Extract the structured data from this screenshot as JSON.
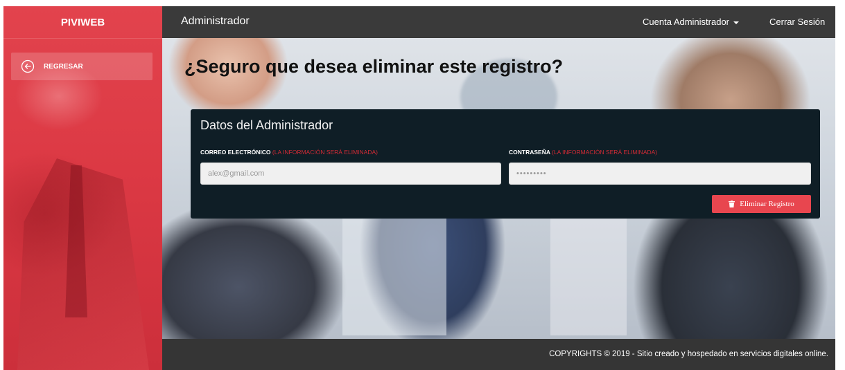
{
  "sidebar": {
    "brand": "PIVIWEB",
    "back_label": "REGRESAR",
    "back_icon": "arrow-left-circle-icon"
  },
  "topbar": {
    "title": "Administrador",
    "account_label": "Cuenta Administrador",
    "logout_label": "Cerrar Sesión"
  },
  "main": {
    "heading": "¿Seguro que desea eliminar este registro?",
    "card": {
      "title": "Datos del Administrador",
      "email_label": "CORREO ELECTRÓNICO",
      "email_note": "(LA INFORMACIÓN SERÁ ELIMINADA)",
      "email_value": "alex@gmail.com",
      "password_label": "CONTRASEÑA",
      "password_note": "(LA INFORMACIÓN SERÁ ELIMINADA)",
      "password_value": "•••••••••",
      "delete_label": "Eliminar Registro",
      "delete_icon": "trash-icon"
    }
  },
  "footer": {
    "copyright": "COPYRIGHTS © 2019 - Sitio creado y hospedado en servicios digitales online."
  },
  "colors": {
    "sidebar": "#dc3944",
    "topbar": "#3a3a3a",
    "card": "#0f1e26",
    "danger": "#e8464f",
    "warning_text": "#d02b35"
  }
}
